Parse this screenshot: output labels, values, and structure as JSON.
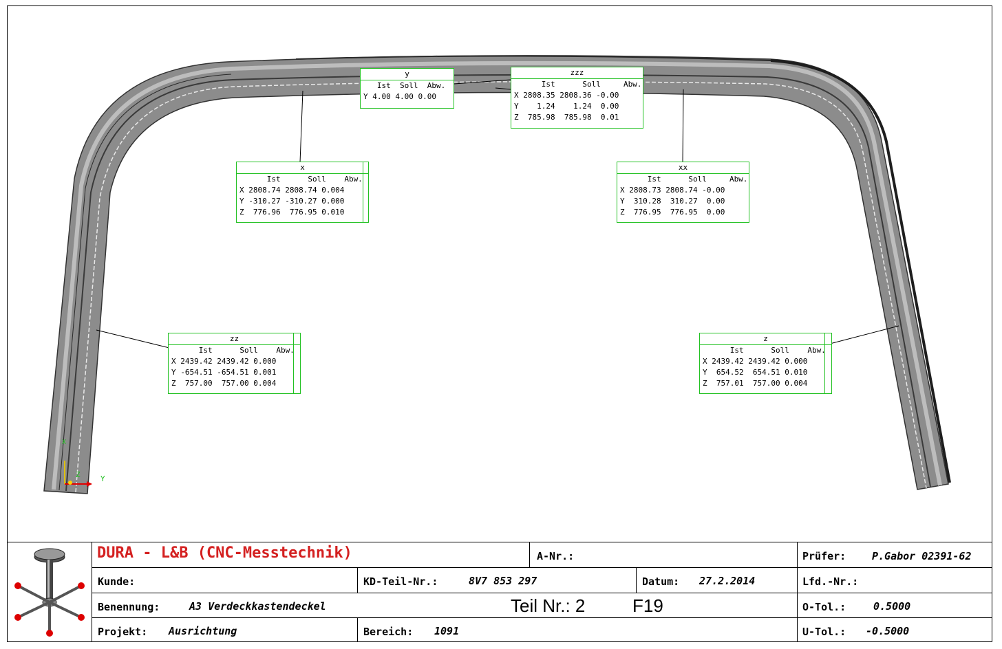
{
  "colors": {
    "box_border": "#22c122",
    "company_text": "#d42020",
    "part_gray": "#8c8c8c"
  },
  "axes": {
    "y_label": "Y",
    "z_label": "Z",
    "small_label": "X"
  },
  "measurements": [
    {
      "title": "y",
      "header": "   Ist  Soll  Abw.",
      "rows": [
        "Y 4.00 4.00 0.00"
      ]
    },
    {
      "title": "zzz",
      "header": "      Ist      Soll     Abw.",
      "rows": [
        "X 2808.35 2808.36 -0.00",
        "Y    1.24    1.24  0.00",
        "Z  785.98  785.98  0.01"
      ]
    },
    {
      "title": "x",
      "header": "      Ist      Soll    Abw.",
      "rows": [
        "X 2808.74 2808.74 0.004",
        "Y -310.27 -310.27 0.000",
        "Z  776.96  776.95 0.010"
      ]
    },
    {
      "title": "xx",
      "header": "      Ist      Soll     Abw.",
      "rows": [
        "X 2808.73 2808.74 -0.00",
        "Y  310.28  310.27  0.00",
        "Z  776.95  776.95  0.00"
      ]
    },
    {
      "title": "zz",
      "header": "      Ist      Soll    Abw.",
      "rows": [
        "X 2439.42 2439.42 0.000",
        "Y -654.51 -654.51 0.001",
        "Z  757.00  757.00 0.004"
      ]
    },
    {
      "title": "z",
      "header": "      Ist      Soll    Abw.",
      "rows": [
        "X 2439.42 2439.42 0.000",
        "Y  654.52  654.51 0.010",
        "Z  757.01  757.00 0.004"
      ]
    }
  ],
  "titleblock": {
    "company": "DURA - L&B (CNC-Messtechnik)",
    "a_nr_label": "A-Nr.:",
    "pruefer_label": "Prüfer:",
    "pruefer_value": "P.Gabor  02391-62",
    "kunde_label": "Kunde:",
    "kd_teil_label": "KD-Teil-Nr.:",
    "kd_teil_value": "8V7 853 297",
    "datum_label": "Datum:",
    "datum_value": "27.2.2014",
    "lfd_label": "Lfd.-Nr.:",
    "benennung_label": "Benennung:",
    "benennung_value": "A3 Verdeckkastendeckel",
    "teil_nr": "Teil Nr.: 2",
    "f_code": "F19",
    "otol_label": "O-Tol.:",
    "otol_value": "0.5000",
    "projekt_label": "Projekt:",
    "projekt_value": "Ausrichtung",
    "bereich_label": "Bereich:",
    "bereich_value": "1091",
    "utol_label": "U-Tol.:",
    "utol_value": "-0.5000"
  }
}
